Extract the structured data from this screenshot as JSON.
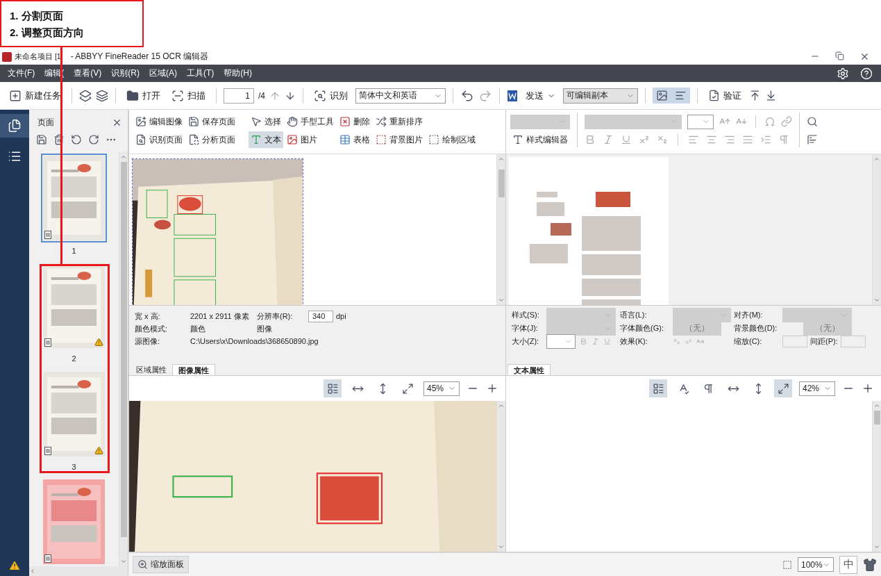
{
  "annotation": {
    "steps": [
      "1.  分割页面",
      "2.  调整页面方向"
    ]
  },
  "window": {
    "title": "未命名项目 [1",
    "title_rest": "- ABBYY FineReader 15 OCR 编辑器"
  },
  "menu": [
    "文件(F)",
    "编辑(",
    "查看(V)",
    "识别(R)",
    "区域(A)",
    "工具(T)",
    "帮助(H)"
  ],
  "toolbar": {
    "new_task": "新建任务",
    "open": "打开",
    "scan": "扫描",
    "page": "1",
    "page_total": "/4",
    "recognize": "识别",
    "language": "简体中文和英语",
    "send": "发送",
    "format": "可编辑副本",
    "verify": "验证",
    "view_image_selected": true,
    "view_text_selected": true
  },
  "sidebar": {
    "pages_selected": true,
    "warning": true
  },
  "pages_panel": {
    "title": "页面",
    "thumbnails": [
      {
        "number": "1",
        "selected": true,
        "warning": false,
        "kind": "page"
      },
      {
        "number": "2",
        "selected": false,
        "warning": true,
        "kind": "page"
      },
      {
        "number": "3",
        "selected": false,
        "warning": true,
        "kind": "page"
      },
      {
        "selected": false,
        "warning": false,
        "kind": "highlighted"
      }
    ]
  },
  "image_ribbon": {
    "rows": [
      [
        {
          "label": "编辑图像",
          "kind": "edit",
          "selected": false
        },
        {
          "label": "保存页面",
          "kind": "save",
          "selected": false
        },
        {
          "label": "选择",
          "kind": "select",
          "selected": false
        },
        {
          "label": "手型工具",
          "kind": "hand",
          "selected": false
        },
        {
          "label": "删除",
          "kind": "delete",
          "selected": false
        },
        {
          "label": "重新排序",
          "kind": "reorder",
          "selected": false
        }
      ],
      [
        {
          "label": "识别页面",
          "kind": "recognize",
          "selected": false
        },
        {
          "label": "分析页面",
          "kind": "analyze",
          "selected": false
        },
        {
          "label": "文本",
          "kind": "text",
          "selected": true
        },
        {
          "label": "图片",
          "kind": "picture",
          "selected": false
        },
        {
          "label": "表格",
          "kind": "table",
          "selected": false
        },
        {
          "label": "背景图片",
          "kind": "background",
          "selected": false
        },
        {
          "label": "绘制区域",
          "kind": "draw",
          "selected": false
        }
      ]
    ]
  },
  "text_ribbon": {
    "style_editor": "样式编辑器"
  },
  "image_properties": {
    "size_label": "宽 x 高:",
    "size_value": "2201 x 2911 像素",
    "resolution_label": "分辨率(R):",
    "resolution": "340",
    "resolution_unit": "dpi",
    "color_label": "颜色模式:",
    "color_value": "颜色",
    "color_type": "图像",
    "source_label": "源图像:",
    "source_value": "C:\\Users\\x\\Downloads\\368650890.jpg",
    "tabs": [
      {
        "label": "区域属性",
        "selected": false
      },
      {
        "label": "图像属性",
        "selected": true
      }
    ]
  },
  "image_zoom": {
    "tools": [
      {
        "kind": "list",
        "selected": true
      },
      {
        "kind": "fit-width",
        "selected": false
      },
      {
        "kind": "fit-height",
        "selected": false
      },
      {
        "kind": "fit-page",
        "selected": false
      }
    ],
    "zoom": "45%"
  },
  "text_properties": {
    "style_label": "样式(S):",
    "font_label": "字体(J):",
    "size_label": "大小(Z):",
    "language_label": "语言(L):",
    "font_color_label": "字体颜色(G):",
    "font_color": "（无）",
    "effects_label": "效果(K):",
    "align_label": "对齐(M):",
    "bg_color_label": "背景颜色(D):",
    "bg_color": "（无）",
    "scale_label": "缩放(C):",
    "spacing_label": "间距(P):",
    "tabs": [
      {
        "label": "文本属性",
        "selected": true
      }
    ]
  },
  "text_zoom": {
    "tools": [
      {
        "kind": "list",
        "selected": true
      },
      {
        "kind": "ligature",
        "selected": false
      },
      {
        "kind": "pilcrow",
        "selected": false
      },
      {
        "kind": "fit-width",
        "selected": false
      },
      {
        "kind": "fit-height",
        "selected": false
      },
      {
        "kind": "fit-page",
        "selected": true
      }
    ],
    "zoom": "42%"
  },
  "status_bar": {
    "zoom_panel": "缩放面板",
    "zoom": "100%",
    "ime": "中"
  }
}
